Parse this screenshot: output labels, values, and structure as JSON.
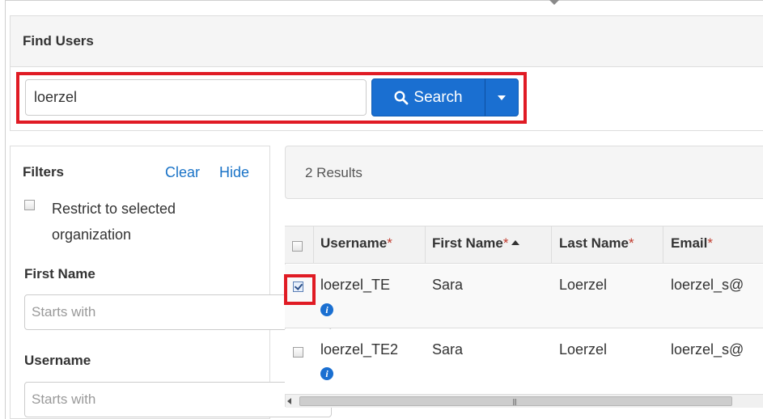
{
  "find_users": {
    "title": "Find Users",
    "search_value": "loerzel",
    "search_button_label": "Search"
  },
  "filters": {
    "title": "Filters",
    "clear_label": "Clear",
    "hide_label": "Hide",
    "restrict_label": "Restrict to selected organization",
    "first_name_label": "First Name",
    "first_name_placeholder": "Starts with",
    "username_label": "Username",
    "username_placeholder": "Starts with"
  },
  "results": {
    "count_text": "2 Results",
    "columns": {
      "username": "Username",
      "first_name": "First Name",
      "last_name": "Last Name",
      "email": "Email",
      "required_marker": "*"
    },
    "rows": [
      {
        "username": "loerzel_TE",
        "first_name": "Sara",
        "last_name": "Loerzel",
        "email": "loerzel_s@",
        "selected": true
      },
      {
        "username": "loerzel_TE2",
        "first_name": "Sara",
        "last_name": "Loerzel",
        "email": "loerzel_s@",
        "selected": false
      }
    ]
  },
  "colors": {
    "accent": "#1a6fd1",
    "link": "#1a73c7",
    "highlight": "#e01b24",
    "required": "#c0392b"
  },
  "icons": [
    "search-icon",
    "caret-down-icon",
    "info-icon",
    "sort-ascending-icon",
    "scroll-left-icon"
  ]
}
